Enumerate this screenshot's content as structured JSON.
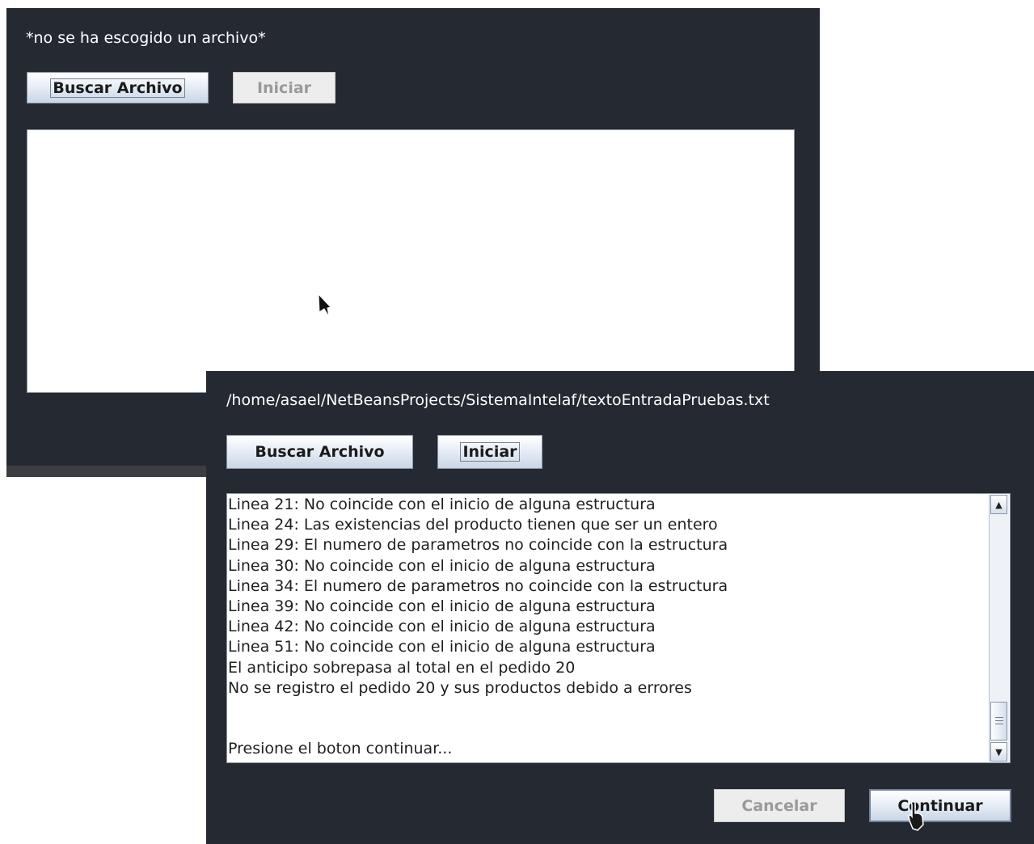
{
  "back_window": {
    "file_label": "*no se ha escogido un archivo*",
    "buttons": {
      "buscar": "Buscar Archivo",
      "iniciar": "Iniciar"
    }
  },
  "front_window": {
    "file_label": "/home/asael/NetBeansProjects/SistemaIntelaf/textoEntradaPruebas.txt",
    "buttons": {
      "buscar": "Buscar Archivo",
      "iniciar": "Iniciar",
      "cancelar": "Cancelar",
      "continuar": "Continuar"
    },
    "log_lines": [
      "Linea 21: No coincide con el inicio de alguna estructura",
      "Linea 24: Las existencias del producto tienen que ser un entero",
      "Linea 29: El numero de parametros no coincide con la estructura",
      "Linea 30: No coincide con el inicio de alguna estructura",
      "Linea 34: El numero de parametros no coincide con la estructura",
      "Linea 39: No coincide con el inicio de alguna estructura",
      "Linea 42: No coincide con el inicio de alguna estructura",
      "Linea 51: No coincide con el inicio de alguna estructura",
      "El anticipo sobrepasa al total en el pedido 20",
      "No se registro el pedido 20 y sus productos debido a errores",
      "",
      "",
      "Presione el boton continuar..."
    ]
  },
  "colors": {
    "panel_bg": "#252932",
    "button_light": "#ffffff",
    "button_dark": "#c9d6e6",
    "text_area_bg": "#ffffff"
  }
}
